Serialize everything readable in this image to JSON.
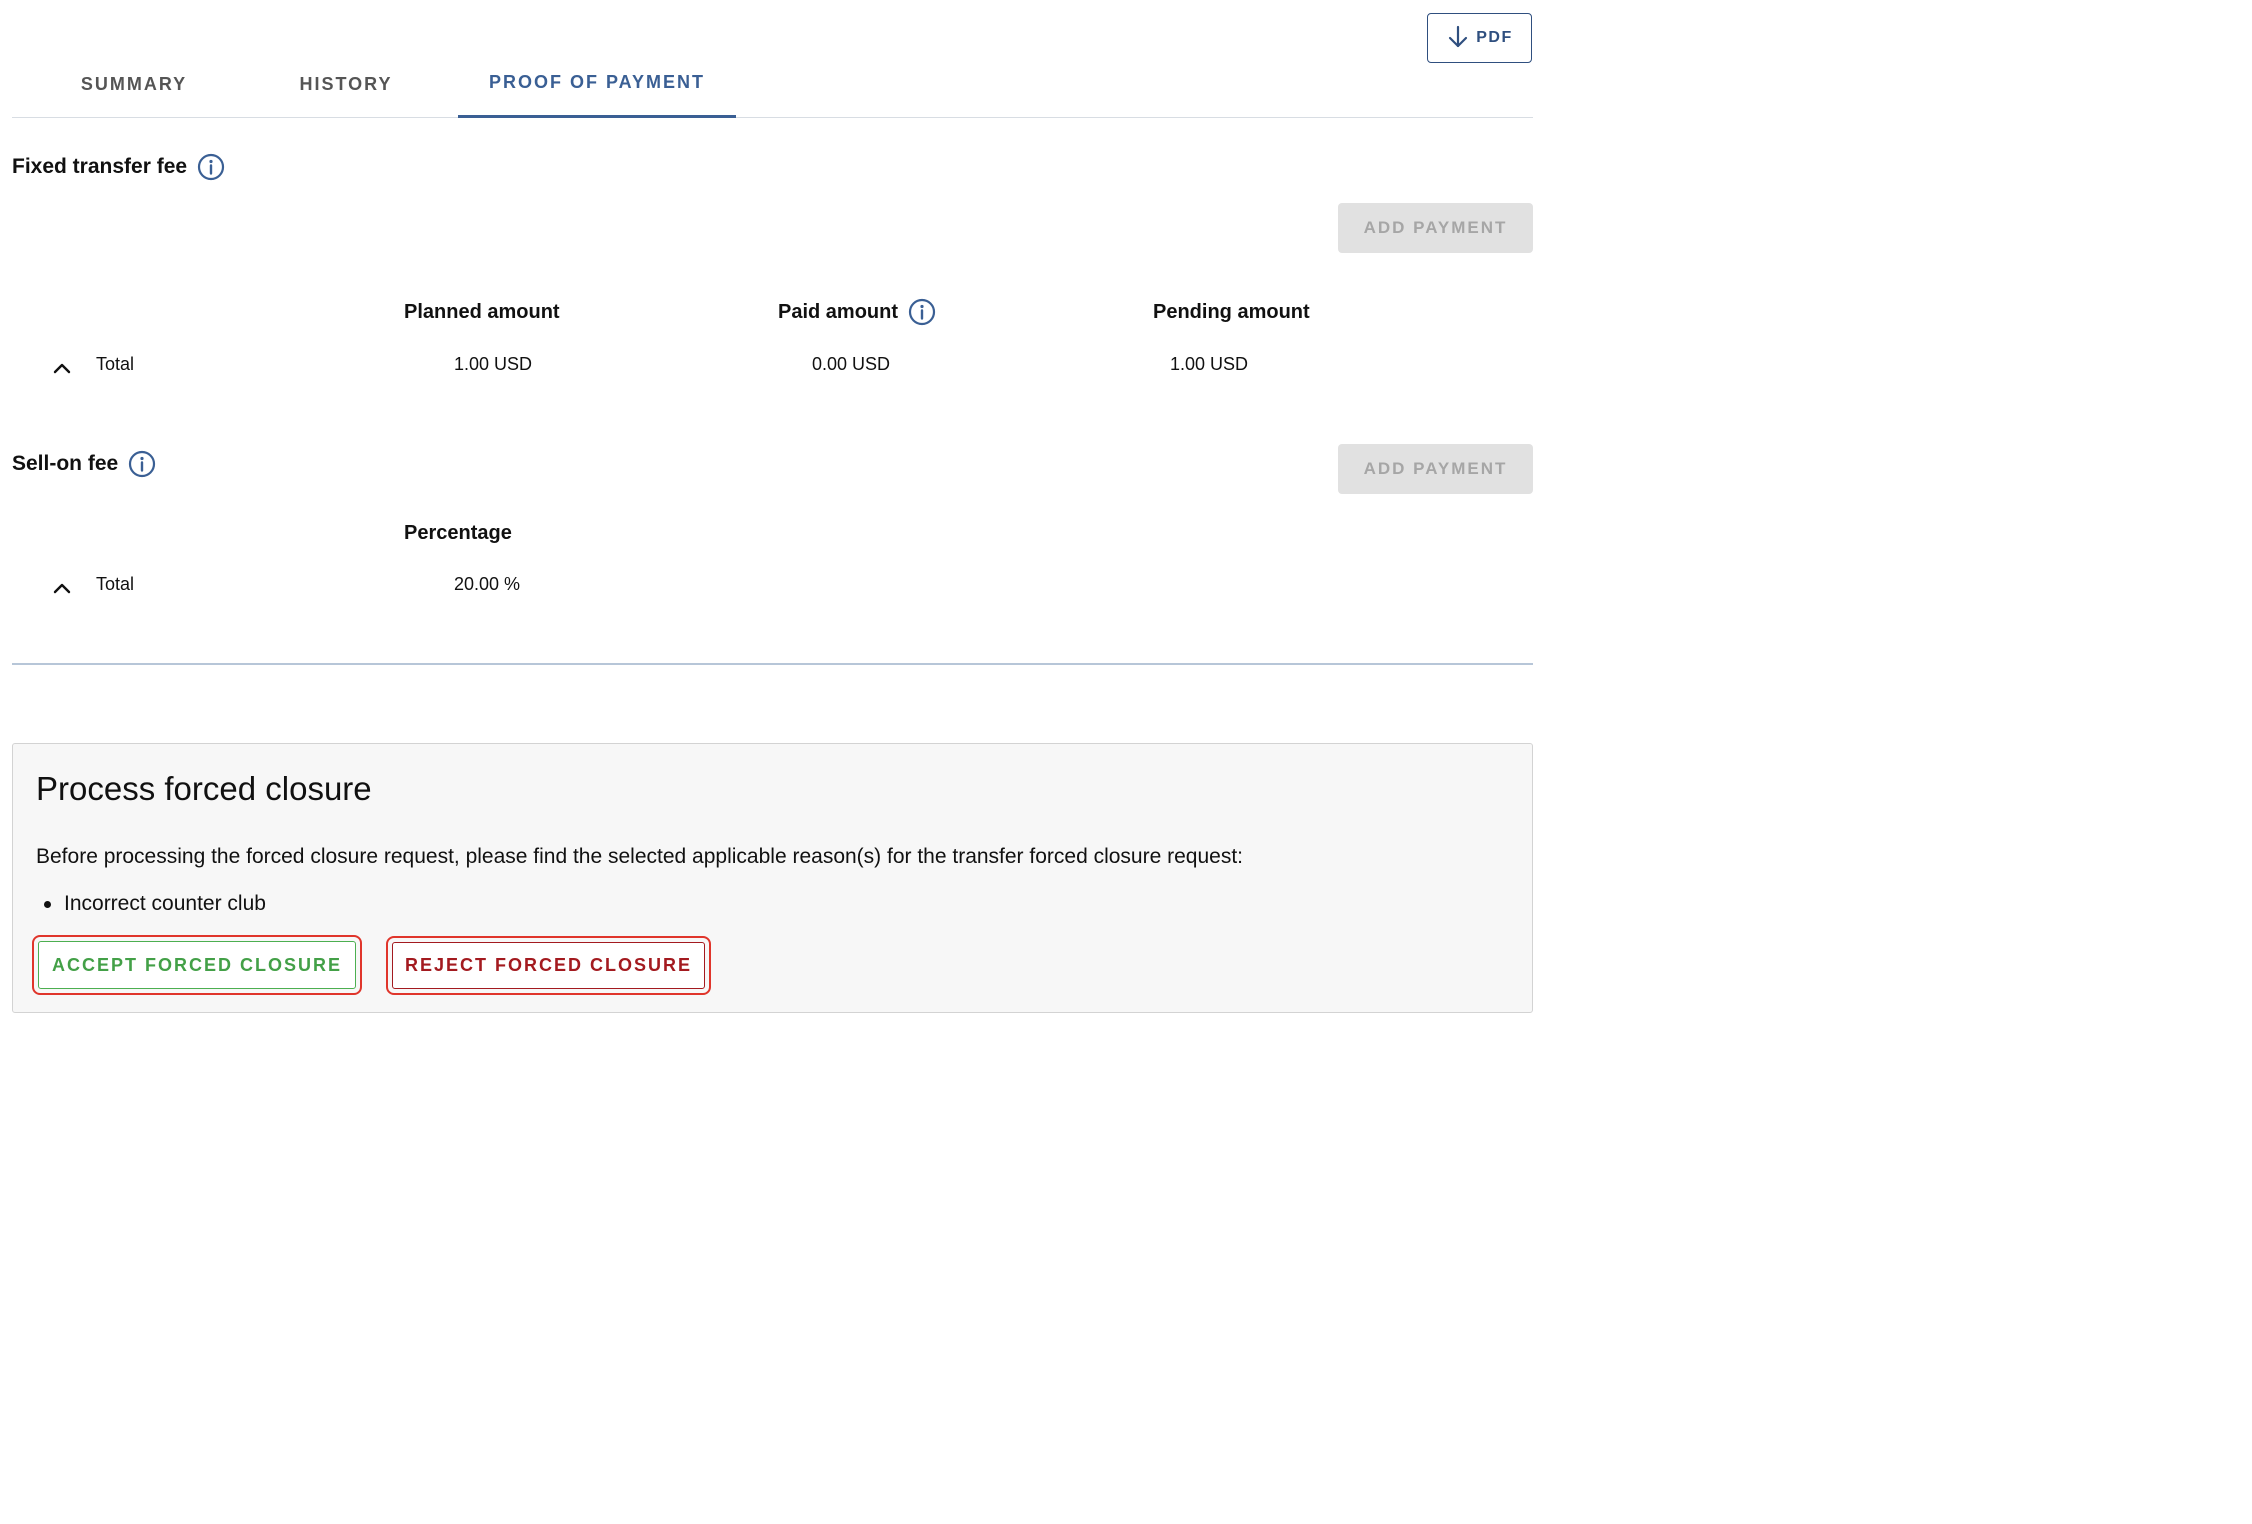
{
  "header": {
    "pdf_label": "PDF"
  },
  "tabs": [
    {
      "label": "SUMMARY",
      "active": false
    },
    {
      "label": "HISTORY",
      "active": false
    },
    {
      "label": "PROOF OF PAYMENT",
      "active": true
    }
  ],
  "fixed_fee": {
    "title": "Fixed transfer fee",
    "add_label": "ADD PAYMENT",
    "columns": {
      "planned": "Planned amount",
      "paid": "Paid amount",
      "pending": "Pending amount"
    },
    "row": {
      "label": "Total",
      "planned": "1.00 USD",
      "paid": "0.00 USD",
      "pending": "1.00 USD"
    }
  },
  "sell_on_fee": {
    "title": "Sell-on fee",
    "add_label": "ADD PAYMENT",
    "columns": {
      "percentage": "Percentage"
    },
    "row": {
      "label": "Total",
      "percentage": "20.00 %"
    }
  },
  "forced_closure": {
    "title": "Process forced closure",
    "description": "Before processing the forced closure request, please find the selected applicable reason(s) for the transfer forced closure request:",
    "reasons": [
      "Incorrect counter club"
    ],
    "accept_label": "ACCEPT FORCED CLOSURE",
    "reject_label": "REJECT FORCED CLOSURE"
  },
  "colors": {
    "accent": "#3a5f94",
    "accept": "#43a047",
    "reject": "#a31a1f",
    "highlight": "#e0352b"
  }
}
